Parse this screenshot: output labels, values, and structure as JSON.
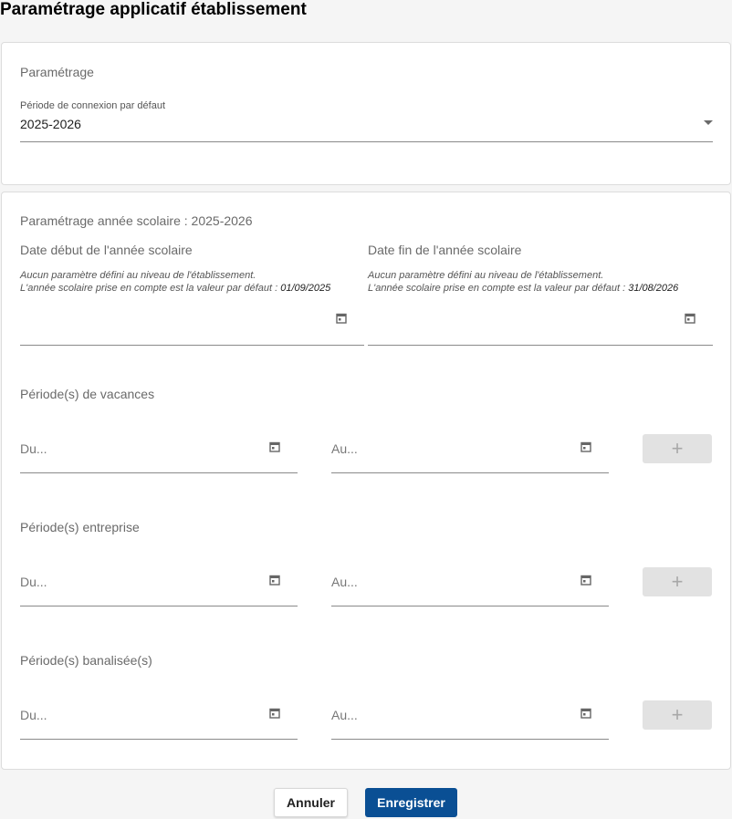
{
  "page": {
    "title": "Paramétrage applicatif établissement"
  },
  "parametrage": {
    "section_title": "Paramétrage",
    "period_label": "Période de connexion par défaut",
    "period_value": "2025-2026"
  },
  "school_year": {
    "section_title": "Paramétrage année scolaire : 2025-2026",
    "start": {
      "label": "Date début de l'année scolaire",
      "note_line1": "Aucun paramètre défini au niveau de l'établissement.",
      "note_line2": "L'année scolaire prise en compte est la valeur par défaut : ",
      "note_value": "01/09/2025"
    },
    "end": {
      "label": "Date fin de l'année scolaire",
      "note_line1": "Aucun paramètre défini au niveau de l'établissement.",
      "note_line2": "L'année scolaire prise en compte est la valeur par défaut : ",
      "note_value": "31/08/2026"
    }
  },
  "periods": [
    {
      "title": "Période(s) de vacances",
      "from_placeholder": "Du...",
      "to_placeholder": "Au...",
      "add_label": "+"
    },
    {
      "title": "Période(s) entreprise",
      "from_placeholder": "Du...",
      "to_placeholder": "Au...",
      "add_label": "+"
    },
    {
      "title": "Période(s) banalisée(s)",
      "from_placeholder": "Du...",
      "to_placeholder": "Au...",
      "add_label": "+"
    }
  ],
  "actions": {
    "cancel_label": "Annuler",
    "save_label": "Enregistrer"
  },
  "icons": {
    "calendar": "calendar-icon",
    "dropdown": "chevron-down-icon",
    "add": "plus-icon"
  },
  "colors": {
    "primary": "#0a4f94",
    "disabled": "#e2e2e2"
  }
}
